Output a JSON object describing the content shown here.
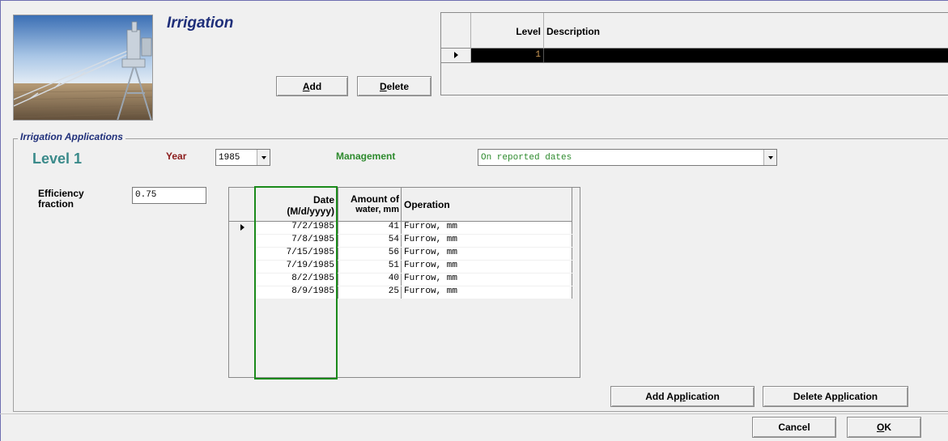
{
  "window": {
    "title": "Irrigation"
  },
  "level_buttons": {
    "add_prefix": "",
    "add_mnemonic": "A",
    "add_rest": "dd",
    "delete_prefix": "",
    "delete_mnemonic": "D",
    "delete_rest": "elete"
  },
  "level_grid": {
    "columns": [
      "Level",
      "Description"
    ],
    "rows": [
      {
        "level": "1",
        "description": "",
        "selected": true
      }
    ]
  },
  "applications": {
    "group_label": "Irrigation Applications",
    "level_label": "Level 1",
    "year_label": "Year",
    "year_value": "1985",
    "management_label": "Management",
    "management_value": "On reported dates",
    "efficiency_label_line1": "Efficiency",
    "efficiency_label_line2": "fraction",
    "efficiency_value": "0.75",
    "columns": {
      "date_line1": "Date",
      "date_line2": "(M/d/yyyy)",
      "amount_line1": "Amount of",
      "amount_line2": "water, mm",
      "operation": "Operation"
    },
    "rows": [
      {
        "date": "7/2/1985",
        "amount": "41",
        "operation": "Furrow, mm",
        "current": true
      },
      {
        "date": "7/8/1985",
        "amount": "54",
        "operation": "Furrow, mm"
      },
      {
        "date": "7/15/1985",
        "amount": "56",
        "operation": "Furrow, mm"
      },
      {
        "date": "7/19/1985",
        "amount": "51",
        "operation": "Furrow, mm"
      },
      {
        "date": "8/2/1985",
        "amount": "40",
        "operation": "Furrow, mm"
      },
      {
        "date": "8/9/1985",
        "amount": "25",
        "operation": "Furrow, mm"
      }
    ],
    "add_application_prefix": "Add Ap",
    "add_application_mnemonic": "p",
    "add_application_rest": "lication",
    "delete_application_prefix": "Delete Ap",
    "delete_application_mnemonic": "p",
    "delete_application_rest": "lication"
  },
  "footer": {
    "cancel_label": "Cancel",
    "ok_mnemonic": "O",
    "ok_rest": "K"
  },
  "colors": {
    "title": "#1f2f7a",
    "year_label": "#8b1a1a",
    "management_label": "#2d8a2d",
    "level_label": "#3a8a8a",
    "date_column_highlight": "#1a8a1a",
    "selected_row_bg": "#000000"
  },
  "icons": {
    "row_pointer": "row-pointer-icon",
    "dropdown": "chevron-down-icon"
  }
}
